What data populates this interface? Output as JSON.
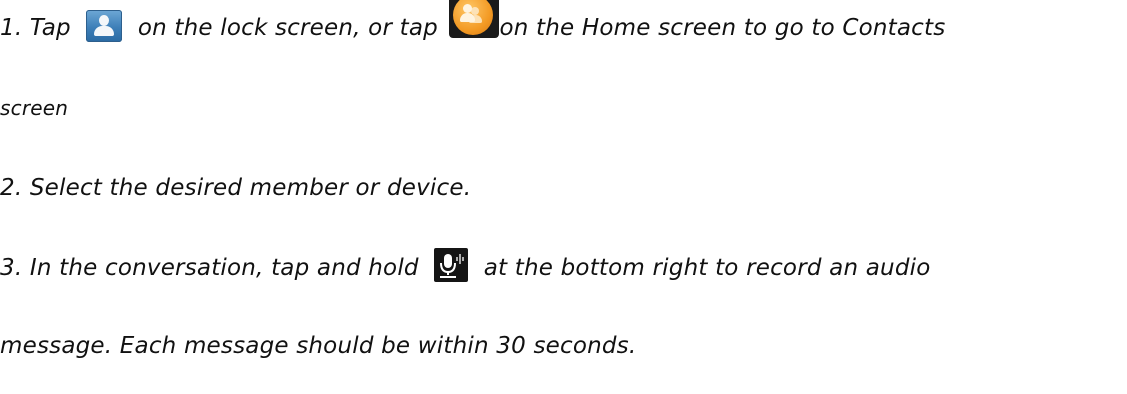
{
  "steps": [
    {
      "number": "1.",
      "part_a": "Tap",
      "part_b": "on the lock screen, or tap",
      "part_c": "on the Home screen to go to Contacts",
      "continuation": "screen"
    },
    {
      "number": "2.",
      "text": "Select the desired member or device."
    },
    {
      "number": "3.",
      "part_a": "In the conversation, tap and hold",
      "part_b": "at the bottom right to record an audio",
      "continuation": "message. Each message should be within 30 seconds."
    }
  ],
  "icons": {
    "lock_contacts": "contacts-person-icon",
    "home_contacts": "contacts-group-icon",
    "record_audio": "microphone-icon",
    "lock_color": "#3d7fb8",
    "home_color": "#f39a24",
    "mic_color": "#151515"
  }
}
